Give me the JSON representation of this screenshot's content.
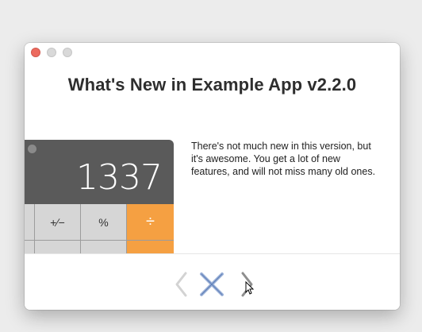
{
  "window": {
    "title": "What's New in Example App v2.2.0"
  },
  "illustration": {
    "display_value": "1337",
    "keys": [
      "+∕−",
      "%",
      "÷"
    ]
  },
  "description": "There's not much new in this version, but it's awesome. You get a lot of new features, and will not miss many old ones.",
  "navigation": {
    "previous_icon": "chevron-left-icon",
    "close_icon": "close-icon",
    "next_icon": "chevron-right-icon"
  },
  "colors": {
    "close_light": "#ec6a5e",
    "accent_blue": "#9fb4d9",
    "operator_orange": "#f5a042",
    "display_gray": "#5a5a5a"
  }
}
